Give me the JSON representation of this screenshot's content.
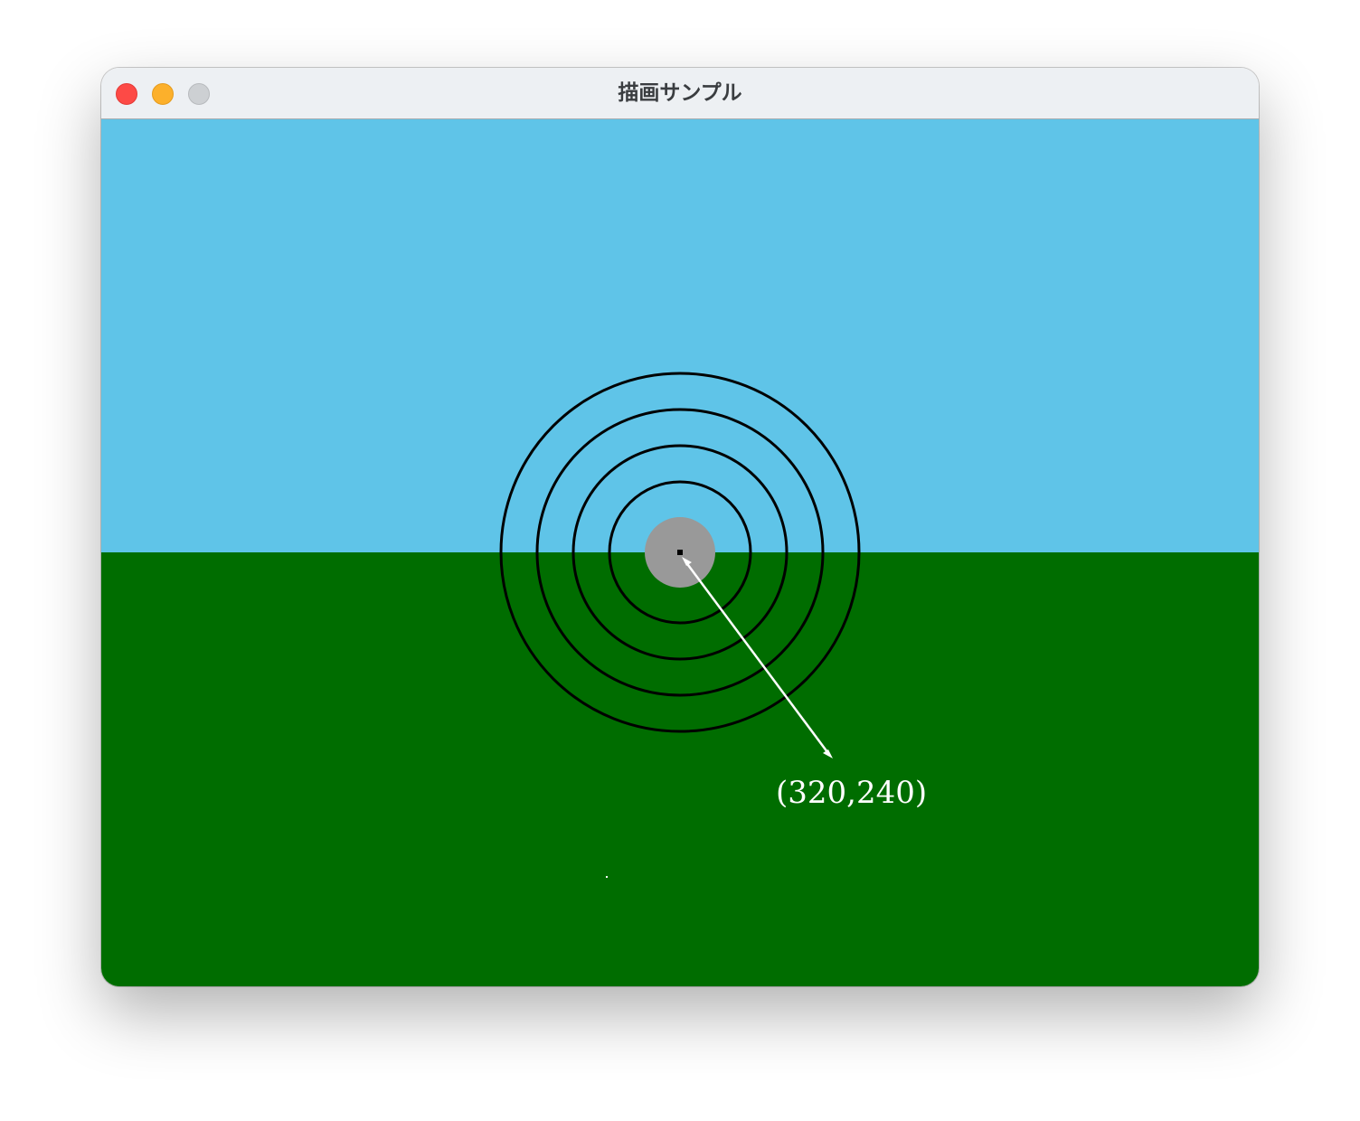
{
  "window": {
    "title": "描画サンプル",
    "traffic_lights": [
      "close",
      "minimize",
      "zoom"
    ]
  },
  "canvas": {
    "sky_color": "#5fc4e8",
    "ground_color": "#006d00",
    "ring_color": "#000000",
    "center_disc_color": "#999999",
    "center_dot_color": "#000000",
    "arrow_color": "#ffffff",
    "ring_count": 4,
    "coordinate_label": "(320,240)"
  }
}
